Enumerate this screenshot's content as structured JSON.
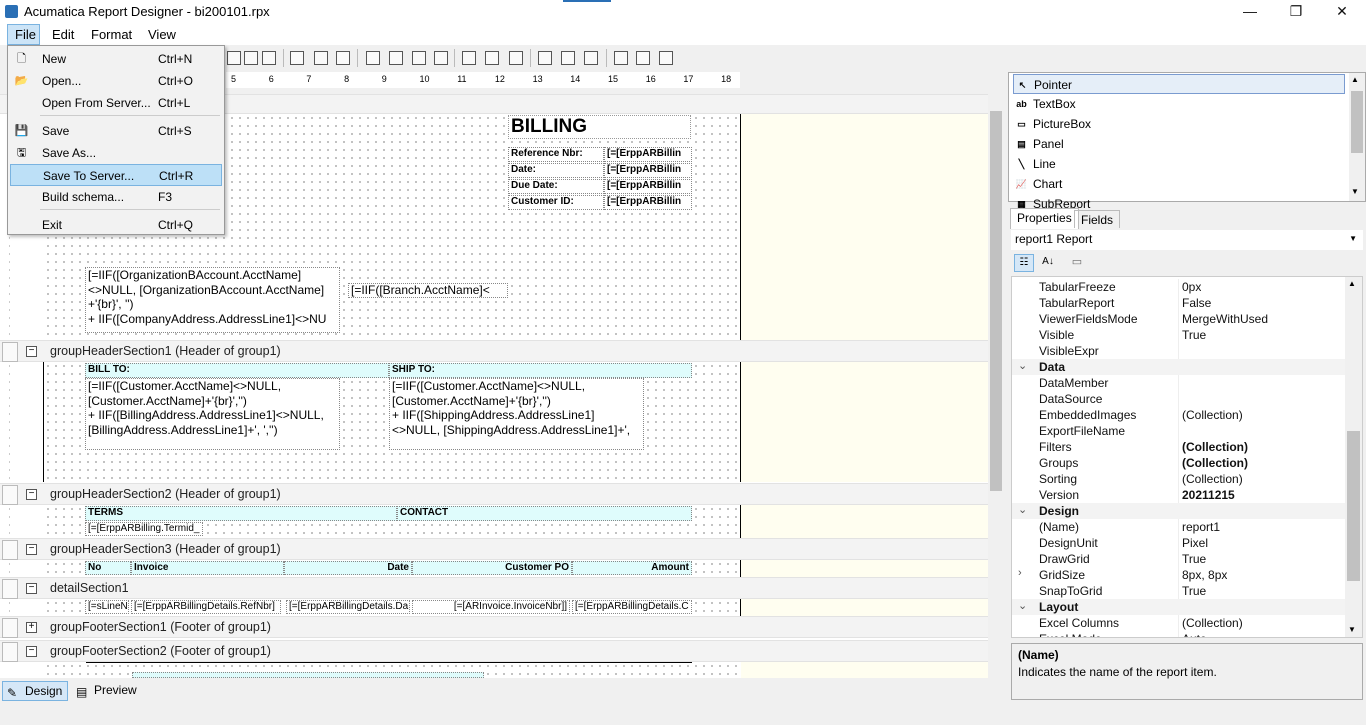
{
  "window": {
    "title": "Acumatica Report Designer - bi200101.rpx",
    "minimize": "—",
    "maximize": "❐",
    "close": "✕"
  },
  "menu": {
    "file": "File",
    "edit": "Edit",
    "format": "Format",
    "view": "View"
  },
  "file_menu": [
    {
      "label": "New",
      "shortcut": "Ctrl+N",
      "icon": "new-icon"
    },
    {
      "label": "Open...",
      "shortcut": "Ctrl+O",
      "icon": "open-icon"
    },
    {
      "label": "Open From Server...",
      "shortcut": "Ctrl+L",
      "icon": ""
    },
    {
      "label": "Save",
      "shortcut": "Ctrl+S",
      "icon": "save-icon"
    },
    {
      "label": "Save As...",
      "shortcut": "",
      "icon": "save-as-icon"
    },
    {
      "label": "Save To Server...",
      "shortcut": "Ctrl+R",
      "icon": "",
      "highlighted": true
    },
    {
      "label": "Build schema...",
      "shortcut": "F3",
      "icon": ""
    },
    {
      "label": "Exit",
      "shortcut": "Ctrl+Q",
      "icon": ""
    }
  ],
  "ruler": {
    "ticks": [
      "5",
      "6",
      "7",
      "8",
      "9",
      "10",
      "11",
      "12",
      "13",
      "14",
      "15",
      "16",
      "17",
      "18"
    ]
  },
  "report": {
    "billing_title": "BILLING",
    "header_fields": [
      {
        "label": "Reference Nbr:",
        "value": "[=[ErppARBillin"
      },
      {
        "label": "Date:",
        "value": "[=[ErppARBillin"
      },
      {
        "label": "Due Date:",
        "value": "[=[ErppARBillin"
      },
      {
        "label": "Customer ID:",
        "value": "[=[ErppARBillin"
      }
    ],
    "org_expr": [
      "[=IIF([OrganizationBAccount.AcctName]",
      "<>NULL, [OrganizationBAccount.AcctName]",
      "+'{br}', '')",
      "+ IIF([CompanyAddress.AddressLine1]<>NU"
    ],
    "branch_expr": "[=IIF([Branch.AcctName]<",
    "sections": {
      "gh1": "groupHeaderSection1 (Header of group1)",
      "gh2": "groupHeaderSection2 (Header of group1)",
      "gh3": "groupHeaderSection3 (Header of group1)",
      "detail": "detailSection1",
      "gf1": "groupFooterSection1 (Footer of group1)",
      "gf2": "groupFooterSection2 (Footer of group1)"
    },
    "bill_to": "BILL TO:",
    "ship_to": "SHIP TO:",
    "bill_expr": [
      "[=IIF([Customer.AcctName]<>NULL,",
      "[Customer.AcctName]+'{br}','')",
      "+ IIF([BillingAddress.AddressLine1]<>NULL,",
      "[BillingAddress.AddressLine1]+', ','')"
    ],
    "ship_expr": [
      "[=IIF([Customer.AcctName]<>NULL,",
      "[Customer.AcctName]+'{br}','')",
      "+ IIF([ShippingAddress.AddressLine1]",
      "<>NULL, [ShippingAddress.AddressLine1]+',"
    ],
    "terms": "TERMS",
    "contact": "CONTACT",
    "termid": "[=[ErppARBilling.Termid_",
    "cols": [
      "No",
      "Invoice",
      "Date",
      "Customer PO",
      "Amount"
    ],
    "detail_cells": [
      "[=sLineN",
      "[=[ErppARBillingDetails.RefNbr]",
      "[=[ErppARBillingDetails.Da",
      "[=[ARInvoice.InvoiceNbr]]",
      "[=[ErppARBillingDetails.C"
    ]
  },
  "bottom_tabs": {
    "design": "Design",
    "preview": "Preview"
  },
  "toolbox": [
    {
      "label": "Pointer",
      "icon": "pointer-icon",
      "glyph": "↖"
    },
    {
      "label": "TextBox",
      "icon": "textbox-icon",
      "glyph": "ab"
    },
    {
      "label": "PictureBox",
      "icon": "picturebox-icon",
      "glyph": "▭"
    },
    {
      "label": "Panel",
      "icon": "panel-icon",
      "glyph": "▤"
    },
    {
      "label": "Line",
      "icon": "line-icon",
      "glyph": "╲"
    },
    {
      "label": "Chart",
      "icon": "chart-icon",
      "glyph": "📈"
    },
    {
      "label": "SubReport",
      "icon": "subreport-icon",
      "glyph": "▦"
    }
  ],
  "props": {
    "tabs": [
      "Properties",
      "Fields"
    ],
    "selected": "report1 Report",
    "rows": [
      {
        "name": "TabularFreeze",
        "value": "0px"
      },
      {
        "name": "TabularReport",
        "value": "False"
      },
      {
        "name": "ViewerFieldsMode",
        "value": "MergeWithUsed"
      },
      {
        "name": "Visible",
        "value": "True"
      },
      {
        "name": "VisibleExpr",
        "value": ""
      },
      {
        "name": "Data",
        "value": "",
        "category": true
      },
      {
        "name": "DataMember",
        "value": ""
      },
      {
        "name": "DataSource",
        "value": ""
      },
      {
        "name": "EmbeddedImages",
        "value": "(Collection)"
      },
      {
        "name": "ExportFileName",
        "value": ""
      },
      {
        "name": "Filters",
        "value": "(Collection)",
        "bold": true
      },
      {
        "name": "Groups",
        "value": "(Collection)",
        "bold": true
      },
      {
        "name": "Sorting",
        "value": "(Collection)"
      },
      {
        "name": "Version",
        "value": "20211215",
        "bold": true
      },
      {
        "name": "Design",
        "value": "",
        "category": true
      },
      {
        "name": "(Name)",
        "value": "report1"
      },
      {
        "name": "DesignUnit",
        "value": "Pixel"
      },
      {
        "name": "DrawGrid",
        "value": "True"
      },
      {
        "name": "GridSize",
        "value": "8px, 8px",
        "expandable": true
      },
      {
        "name": "SnapToGrid",
        "value": "True"
      },
      {
        "name": "Layout",
        "value": "",
        "category": true
      },
      {
        "name": "Excel Columns",
        "value": "(Collection)"
      },
      {
        "name": "Excel Mode",
        "value": "Auto"
      }
    ],
    "desc_title": "(Name)",
    "desc_text": "Indicates the name of the report item."
  }
}
